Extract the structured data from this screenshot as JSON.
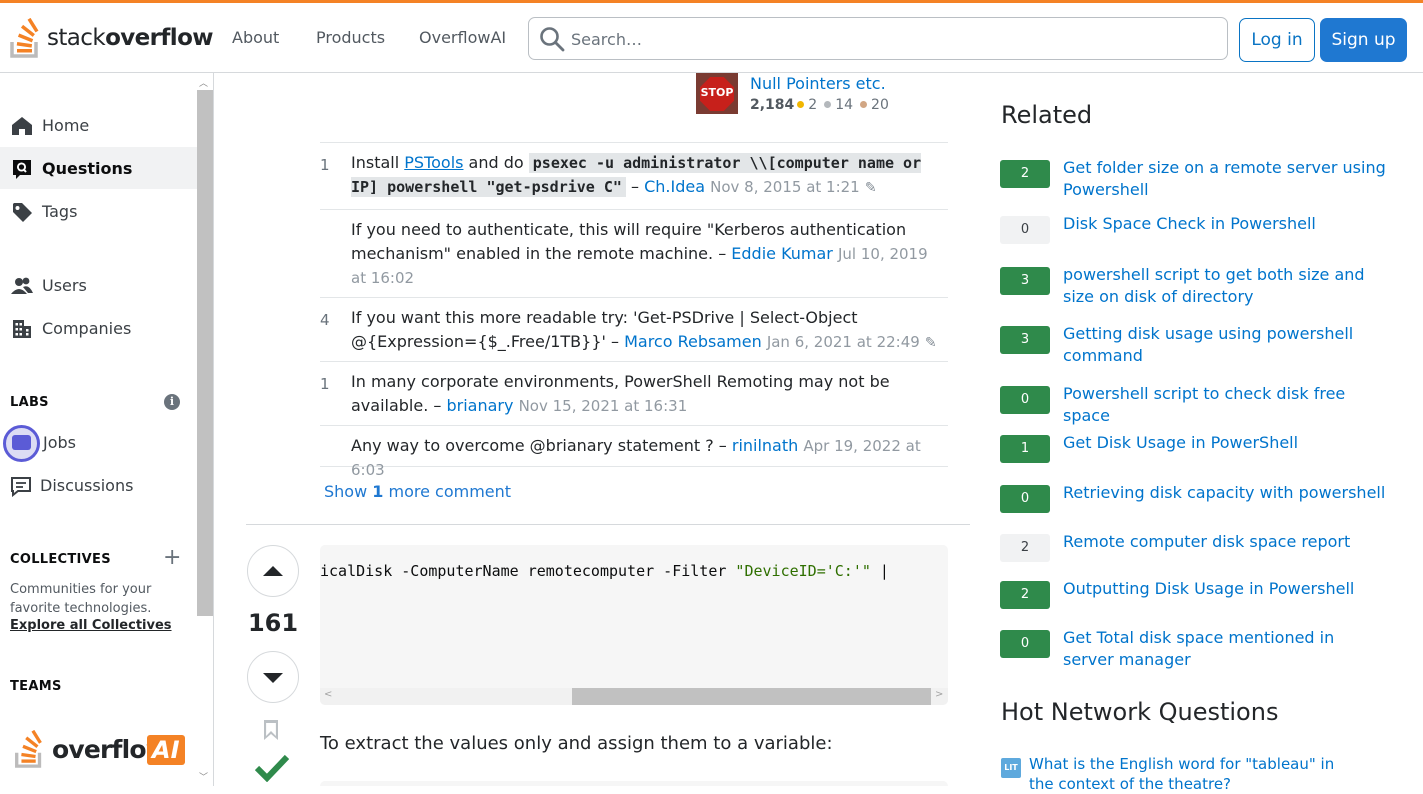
{
  "header": {
    "logo_text_light": "stack",
    "logo_text_bold": "overflow",
    "nav": [
      "About",
      "Products",
      "OverflowAI"
    ],
    "search_placeholder": "Search…",
    "login": "Log in",
    "signup": "Sign up"
  },
  "leftnav": {
    "items": [
      {
        "label": "Home",
        "icon": "home-icon"
      },
      {
        "label": "Questions",
        "icon": "questions-icon"
      },
      {
        "label": "Tags",
        "icon": "tag-icon"
      },
      {
        "label": "Users",
        "icon": "users-icon"
      },
      {
        "label": "Companies",
        "icon": "companies-icon"
      }
    ],
    "labs_title": "LABS",
    "labs_items": [
      {
        "label": "Jobs",
        "icon": "briefcase-icon"
      },
      {
        "label": "Discussions",
        "icon": "discussions-icon"
      }
    ],
    "collectives_title": "COLLECTIVES",
    "collectives_desc": "Communities for your favorite technologies.",
    "collectives_link": "Explore all Collectives",
    "teams_title": "TEAMS",
    "overflow_ai_word": "overflow",
    "overflow_ai_badge": "AI"
  },
  "post_owner": {
    "avatar_text": "STOP",
    "name": "Null Pointers etc.",
    "reputation": "2,184",
    "gold": "2",
    "silver": "14",
    "bronze": "20"
  },
  "comments": [
    {
      "score": "1",
      "text_before": "Install ",
      "link": "PSTools",
      "text_middle": " and do ",
      "code": "psexec -u administrator \\\\[computer name or IP] powershell \"get-psdrive C\"",
      "sep": " – ",
      "user": "Ch.Idea",
      "date": "Nov 8, 2015 at 1:21",
      "edited": true
    },
    {
      "score": "",
      "text": "If you need to authenticate, this will require \"Kerberos authentication mechanism\" enabled in the remote machine.",
      "sep": " – ",
      "user": "Eddie Kumar",
      "date": "Jul 10, 2019 at 16:02"
    },
    {
      "score": "4",
      "text": "If you want this more readable try: 'Get-PSDrive | Select-Object @{Expression={$_.Free/1TB}}'",
      "sep": " – ",
      "user": "Marco Rebsamen",
      "date": "Jan 6, 2021 at 22:49",
      "edited": true
    },
    {
      "score": "1",
      "text": "In many corporate environments, PowerShell Remoting may not be available.",
      "sep": " – ",
      "user": "brianary",
      "date": "Nov 15, 2021 at 16:31"
    },
    {
      "score": "",
      "text": "Any way to overcome @brianary statement ?",
      "sep": " – ",
      "user": "rinilnath",
      "date": "Apr 19, 2022 at 6:03"
    }
  ],
  "show_more": {
    "prefix": "Show ",
    "count": "1",
    "suffix": " more comment"
  },
  "answer": {
    "votes": "161",
    "code_plain": "icalDisk -ComputerName remotecomputer -Filter ",
    "code_string": "\"DeviceID='C:'\"",
    "code_tail": " |",
    "text": "To extract the values only and assign them to a variable:"
  },
  "related": {
    "title": "Related",
    "items": [
      {
        "count": "2",
        "answered": true,
        "title": "Get folder size on a remote server using Powershell"
      },
      {
        "count": "0",
        "answered": false,
        "title": "Disk Space Check in Powershell"
      },
      {
        "count": "3",
        "answered": true,
        "title": "powershell script to get both size and size on disk of directory"
      },
      {
        "count": "3",
        "answered": true,
        "title": "Getting disk usage using powershell command"
      },
      {
        "count": "0",
        "answered": true,
        "title": "Powershell script to check disk free space"
      },
      {
        "count": "1",
        "answered": true,
        "title": "Get Disk Usage in PowerShell"
      },
      {
        "count": "0",
        "answered": true,
        "title": "Retrieving disk capacity with powershell"
      },
      {
        "count": "2",
        "answered": false,
        "title": "Remote computer disk space report"
      },
      {
        "count": "2",
        "answered": true,
        "title": "Outputting Disk Usage in Powershell"
      },
      {
        "count": "0",
        "answered": true,
        "title": "Get Total disk space mentioned in server manager"
      }
    ]
  },
  "hot": {
    "title": "Hot Network Questions",
    "site_icon_text": "LIT",
    "item": "What is the English word for \"tableau\" in the context of the theatre?"
  },
  "colors": {
    "accent": "#f48225",
    "link": "#0074cc",
    "button": "#1f78d1",
    "answered": "#2f8a4b",
    "accepted": "#2f8a4b"
  }
}
